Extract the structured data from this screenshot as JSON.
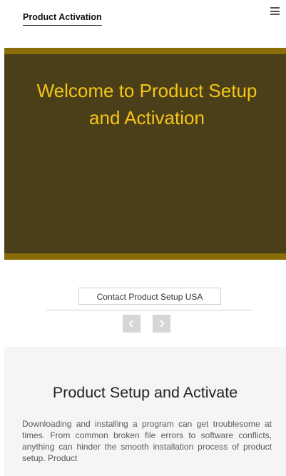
{
  "header": {
    "brand": "Product Activation",
    "menu_icon": "hamburger-menu-icon"
  },
  "hero": {
    "title": "Welcome to Product Setup and Activation",
    "colors": {
      "background": "#4b3f19",
      "band": "#8a6d09",
      "title": "#f3c518"
    }
  },
  "carousel": {
    "contact_label": "Contact Product Setup USA",
    "prev_icon": "chevron-left-icon",
    "next_icon": "chevron-right-icon"
  },
  "about": {
    "title": "Product Setup and Activate",
    "body": "Downloading and installing a program can get troublesome at times. From common broken file errors to software conflicts, anything can hinder the smooth installation process of product setup. Product"
  }
}
